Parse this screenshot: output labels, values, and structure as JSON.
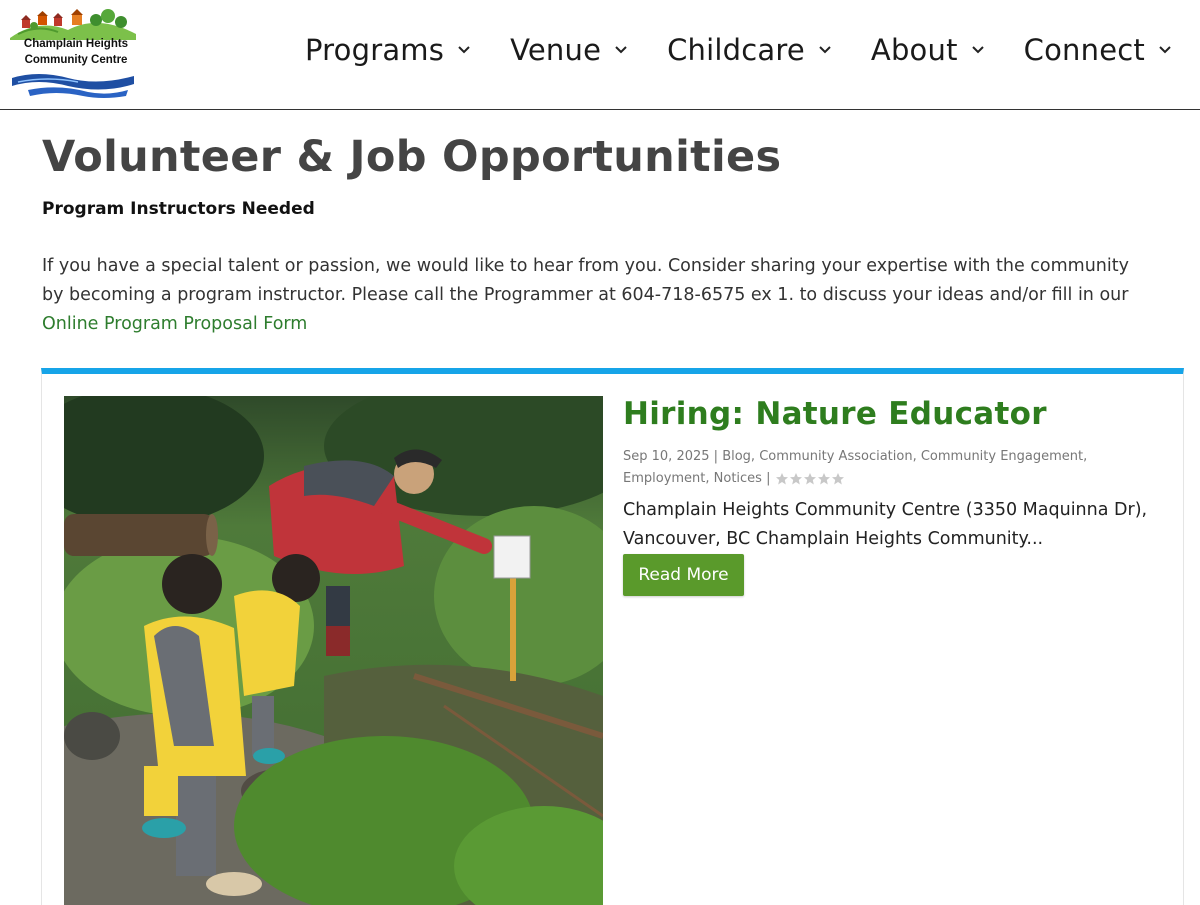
{
  "header": {
    "logo": {
      "line1": "Champlain Heights",
      "line2": "Community Centre"
    },
    "nav": [
      {
        "label": "Programs"
      },
      {
        "label": "Venue"
      },
      {
        "label": "Childcare"
      },
      {
        "label": "About"
      },
      {
        "label": "Connect"
      }
    ]
  },
  "main": {
    "title": "Volunteer & Job Opportunities",
    "subhead": "Program Instructors Needed",
    "intro_text": "If you have a special talent or passion, we would like to hear from you. Consider sharing your expertise with the community by becoming a program instructor. Please call the Programmer at  604-718-6575 ex 1. to discuss your ideas and/or fill in our ",
    "intro_link": "Online Program Proposal Form"
  },
  "post": {
    "title": "Hiring: Nature Educator",
    "date": "Sep 10, 2025",
    "sep1": " | ",
    "categories": "Blog, Community Association, Community Engagement, Employment, Notices",
    "sep2": " | ",
    "rating": 0,
    "excerpt": "Champlain Heights Community Centre (3350 Maquinna Dr), Vancouver, BC Champlain Heights Community...",
    "read_more_label": "Read More",
    "image_icon": "nature-photo"
  },
  "colors": {
    "accent_blue": "#16a4e8",
    "title_green": "#2e7d1e",
    "link_green": "#2e7d2e",
    "button_green": "#5a9a2b"
  }
}
